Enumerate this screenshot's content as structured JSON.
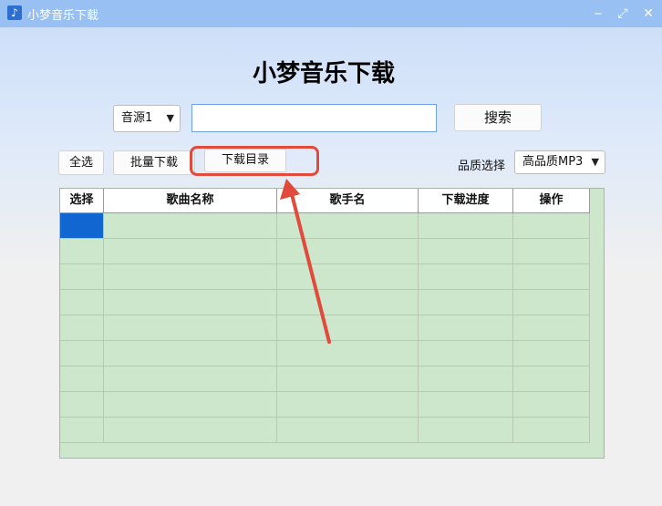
{
  "window": {
    "title": "小梦音乐下载",
    "icon": "music-note-icon",
    "controls": {
      "minimize": "‒",
      "maximize": "⤢",
      "close": "✕"
    }
  },
  "heading": "小梦音乐下载",
  "search": {
    "source": {
      "selected": "音源1"
    },
    "input_value": "",
    "button": "搜索"
  },
  "toolbar": {
    "select_all": "全选",
    "batch_download": "批量下载",
    "download_dir": "下载目录",
    "quality_label": "品质选择",
    "quality": {
      "selected": "高品质MP3"
    }
  },
  "table": {
    "columns": [
      "选择",
      "歌曲名称",
      "歌手名",
      "下载进度",
      "操作"
    ],
    "rows": [
      [
        "",
        "",
        "",
        "",
        ""
      ],
      [
        "",
        "",
        "",
        "",
        ""
      ],
      [
        "",
        "",
        "",
        "",
        ""
      ],
      [
        "",
        "",
        "",
        "",
        ""
      ],
      [
        "",
        "",
        "",
        "",
        ""
      ],
      [
        "",
        "",
        "",
        "",
        ""
      ],
      [
        "",
        "",
        "",
        "",
        ""
      ],
      [
        "",
        "",
        "",
        "",
        ""
      ],
      [
        "",
        "",
        "",
        "",
        ""
      ]
    ],
    "selected_cell": {
      "row": 0,
      "col": 0
    }
  },
  "annotation": {
    "color": "#e24a3b",
    "target": "download_dir"
  },
  "colors": {
    "titlebar": "#99c0f3",
    "grid_bg": "#cde7cc",
    "selection": "#1166d2",
    "input_border": "#6ea2e8"
  }
}
